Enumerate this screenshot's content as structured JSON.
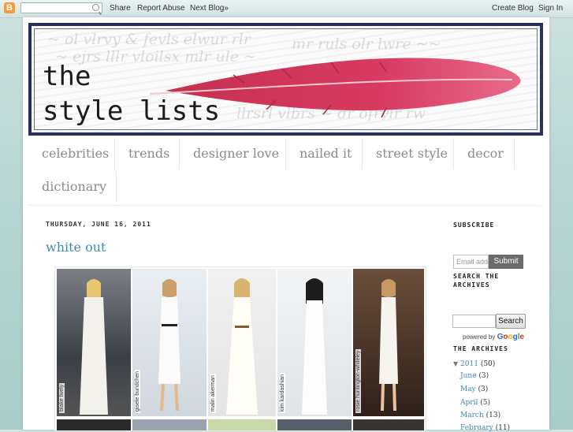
{
  "navbar": {
    "logo": "B",
    "search_placeholder": "",
    "share": "Share",
    "report": "Report Abuse",
    "next": "Next Blog»",
    "create": "Create Blog",
    "signin": "Sign In"
  },
  "header": {
    "title_line1": "the",
    "title_line2": "style lists"
  },
  "menu": [
    "celebrities",
    "trends",
    "designer love",
    "nailed it",
    "street style",
    "decor",
    "dictionary"
  ],
  "post": {
    "date": "THURSDAY, JUNE 16, 2011",
    "title": "white out",
    "captions": [
      "blake lively",
      "gisele bundchen",
      "malin akerman",
      "kim kardashian",
      "rosie huntington-whiteley"
    ]
  },
  "sidebar": {
    "subscribe_heading": "SUBSCRIBE",
    "email_placeholder": "Email address",
    "submit": "Submit",
    "search_heading_1": "SEARCH THE",
    "search_heading_2": "ARCHIVES",
    "search_button": "Search",
    "powered_by": "powered by",
    "google": [
      "G",
      "o",
      "o",
      "g",
      "l",
      "e"
    ],
    "archives_heading": "THE ARCHIVES",
    "year": "2011",
    "year_count": "(50)",
    "months": [
      {
        "name": "June",
        "count": "(3)"
      },
      {
        "name": "May",
        "count": "(3)"
      },
      {
        "name": "April",
        "count": "(5)"
      },
      {
        "name": "March",
        "count": "(13)"
      },
      {
        "name": "February",
        "count": "(11)"
      }
    ]
  },
  "colors": {
    "accent_link": "#3e8ab8",
    "header_border": "#2b2f5e",
    "feather": "#d2345a"
  }
}
